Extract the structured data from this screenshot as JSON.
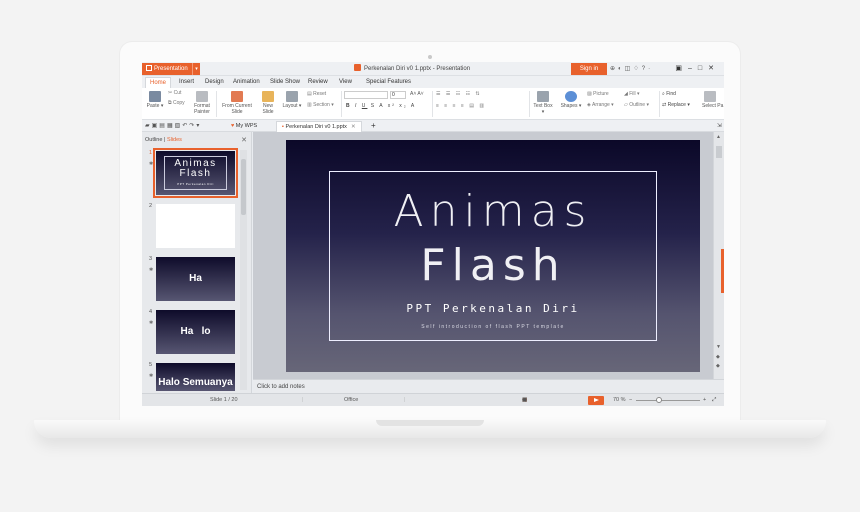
{
  "app": {
    "menu_label": "Presentation",
    "document_title": "Perkenalan Diri v0 1.pptx - Presentation",
    "sign_in": "Sign in"
  },
  "menu_tabs": [
    "Home",
    "Insert",
    "Design",
    "Animation",
    "Slide Show",
    "Review",
    "View",
    "Special Features"
  ],
  "ribbon": {
    "paste": "Paste",
    "cut": "Cut",
    "copy": "Copy",
    "format_painter": "Format Painter",
    "from_current_slide": "From Current Slide",
    "new_slide": "New Slide",
    "layout": "Layout",
    "reset": "Reset",
    "section": "Section",
    "font_size": "0",
    "text_box": "Text Box",
    "shapes": "Shapes",
    "picture": "Picture",
    "arrange": "Arrange",
    "fill": "Fill",
    "outline": "Outline",
    "find": "Find",
    "replace": "Replace",
    "select_pane": "Select Pa"
  },
  "doc_tabs": [
    "My WPS",
    "Perkenalan Diri v0 1.pptx"
  ],
  "left_panel": {
    "outline_tab": "Outline",
    "slides_tab": "Slides",
    "thumbnails": [
      {
        "num": "1",
        "title1": "Animas",
        "title2": "Flash",
        "subtitle": "PPT Perkenalan Diri"
      },
      {
        "num": "2",
        "text": ""
      },
      {
        "num": "3",
        "text": "Ha"
      },
      {
        "num": "4",
        "text": "Ha   lo"
      },
      {
        "num": "5",
        "text": "Halo Semuanya"
      }
    ]
  },
  "slide": {
    "title_line1": "Animas",
    "title_line2": "Flash",
    "subtitle": "PPT Perkenalan Diri",
    "tagline": "Self introduction of flash PPT template"
  },
  "notes_placeholder": "Click to add notes",
  "status": {
    "slide_counter": "Slide 1 / 20",
    "theme": "Office",
    "zoom": "70 %"
  }
}
